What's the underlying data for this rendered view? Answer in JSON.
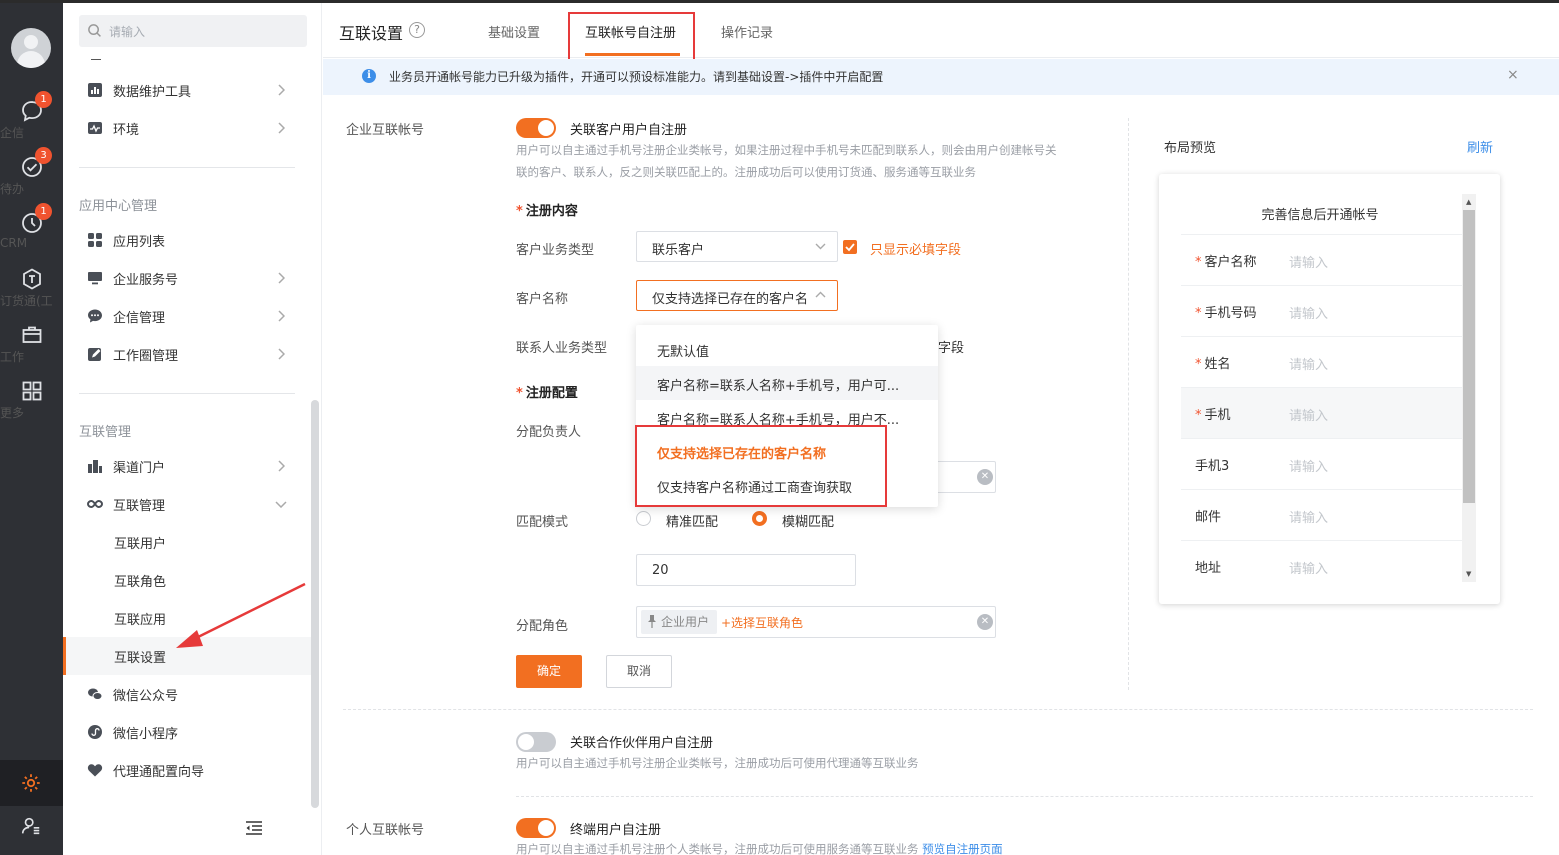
{
  "rail": {
    "items": [
      {
        "label": "企信",
        "badge": "1",
        "icon": "chat-icon"
      },
      {
        "label": "待办",
        "badge": "3",
        "icon": "check-circle-icon"
      },
      {
        "label": "CRM",
        "badge": "1",
        "icon": "crm-icon"
      },
      {
        "label": "订货通(工",
        "badge": "",
        "icon": "order-icon"
      },
      {
        "label": "工作",
        "badge": "",
        "icon": "briefcase-icon"
      },
      {
        "label": "更多",
        "badge": "",
        "icon": "grid-icon"
      }
    ]
  },
  "sidebar": {
    "search_placeholder": "请输入",
    "top_items": [
      {
        "label": "数据维护工具",
        "icon": "bar-chart-icon"
      },
      {
        "label": "环境",
        "icon": "pulse-icon"
      }
    ],
    "group_app": "应用中心管理",
    "app_items": [
      {
        "label": "应用列表",
        "icon": "apps-icon"
      },
      {
        "label": "企业服务号",
        "icon": "monitor-icon"
      },
      {
        "label": "企信管理",
        "icon": "message-icon"
      },
      {
        "label": "工作圈管理",
        "icon": "edit-icon"
      }
    ],
    "group_interconnect": "互联管理",
    "ic_items": [
      {
        "label": "渠道门户",
        "icon": "building-icon"
      },
      {
        "label": "互联管理",
        "icon": "infinity-icon"
      }
    ],
    "sub_items": [
      "互联用户",
      "互联角色",
      "互联应用",
      "互联设置"
    ],
    "bottom_items": [
      {
        "label": "微信公众号",
        "icon": "wechat-icon"
      },
      {
        "label": "微信小程序",
        "icon": "miniprogram-icon"
      },
      {
        "label": "代理通配置向导",
        "icon": "heart-icon"
      }
    ]
  },
  "header": {
    "title": "互联设置",
    "help": "?",
    "tabs": [
      "基础设置",
      "互联帐号自注册",
      "操作记录"
    ]
  },
  "notice": {
    "text": "业务员开通帐号能力已升级为插件，开通可以预设标准能力。请到基础设置->插件中开启配置",
    "close": "×"
  },
  "form": {
    "section_enterprise": "企业互联帐号",
    "toggle1_label": "关联客户用户自注册",
    "toggle1_desc_1": "用户可以自主通过手机号注册企业类帐号，如果注册过程中手机号未匹配到联系人，则会由用户创建帐号关",
    "toggle1_desc_2": "联的客户、联系人，反之则关联匹配上的。注册成功后可以使用订货通、服务通等互联业务",
    "reg_content_title": "注册内容",
    "customer_type_label": "客户业务类型",
    "customer_type_value": "联乐客户",
    "only_required_label": "只显示必填字段",
    "customer_name_label": "客户名称",
    "customer_name_value": "仅支持选择已存在的客户名",
    "contact_type_label": "联系人业务类型",
    "contact_type_trailing": "字段",
    "reg_config_title": "注册配置",
    "assign_owner_label": "分配负责人",
    "match_mode_label": "匹配模式",
    "match_exact": "精准匹配",
    "match_fuzzy": "模糊匹配",
    "match_threshold": "20",
    "assign_role_label": "分配角色",
    "role_chip": "企业用户",
    "add_role": "+选择互联角色",
    "confirm": "确定",
    "cancel": "取消",
    "toggle2_label": "关联合作伙伴用户自注册",
    "toggle2_desc": "用户可以自主通过手机号注册企业类帐号，注册成功后可使用代理通等互联业务",
    "section_personal": "个人互联帐号",
    "toggle3_label": "终端用户自注册",
    "toggle3_desc": "用户可以自主通过手机号注册个人类帐号，注册成功后可使用服务通等互联业务",
    "toggle3_link": "预览自注册页面"
  },
  "dropdown": {
    "options": [
      "无默认值",
      "客户名称=联系人名称+手机号，用户可...",
      "客户名称=联系人名称+手机号，用户不...",
      "仅支持选择已存在的客户名称",
      "仅支持客户名称通过工商查询获取"
    ]
  },
  "preview": {
    "title": "布局预览",
    "refresh": "刷新",
    "phone_title": "完善信息后开通帐号",
    "rows": [
      {
        "label": "客户名称",
        "required": true,
        "placeholder": "请输入"
      },
      {
        "label": "手机号码",
        "required": true,
        "placeholder": "请输入"
      },
      {
        "label": "姓名",
        "required": true,
        "placeholder": "请输入"
      },
      {
        "label": "手机",
        "required": true,
        "placeholder": "请输入"
      },
      {
        "label": "手机3",
        "required": false,
        "placeholder": "请输入"
      },
      {
        "label": "邮件",
        "required": false,
        "placeholder": "请输入"
      },
      {
        "label": "地址",
        "required": false,
        "placeholder": "请输入"
      }
    ]
  },
  "colors": {
    "accent": "#f26f21",
    "annotation_red": "#e63a3a",
    "link_blue": "#3d8ee8"
  }
}
